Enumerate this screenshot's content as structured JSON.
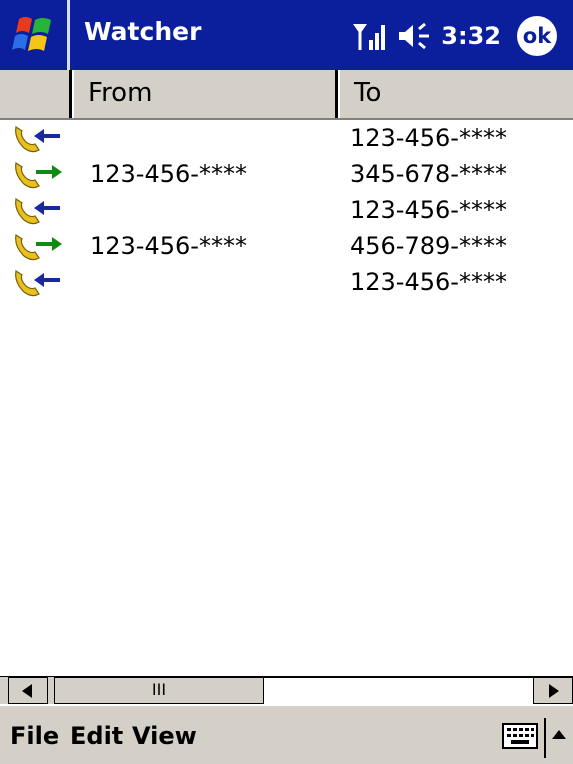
{
  "titlebar": {
    "app_title": "Watcher",
    "clock": "3:32",
    "ok_label": "ok",
    "icons": [
      "windows-start-icon",
      "signal-icon",
      "speaker-icon"
    ]
  },
  "columns": {
    "from": "From",
    "to": "To"
  },
  "rows": [
    {
      "direction": "incoming",
      "from": "",
      "to": "123-456-****"
    },
    {
      "direction": "outgoing",
      "from": "123-456-****",
      "to": "345-678-****"
    },
    {
      "direction": "incoming",
      "from": "",
      "to": "123-456-****"
    },
    {
      "direction": "outgoing",
      "from": "123-456-****",
      "to": "456-789-****"
    },
    {
      "direction": "incoming",
      "from": "",
      "to": "123-456-****"
    }
  ],
  "scrollbar": {
    "thumb_grip": "III"
  },
  "menu": {
    "file": "File",
    "edit": "Edit",
    "view": "View"
  },
  "colors": {
    "titlebar": "#0b1f9c",
    "incoming_arrow": "#1a2a9c",
    "outgoing_arrow": "#108a10",
    "handset": "#e8c020"
  }
}
